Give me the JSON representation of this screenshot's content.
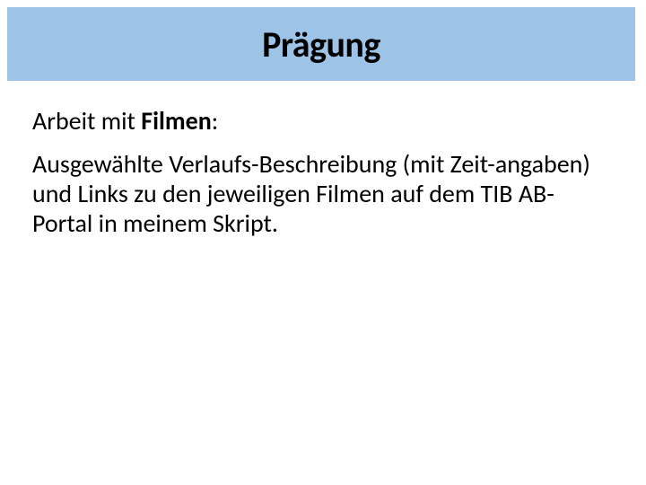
{
  "title": "Prägung",
  "subheading": {
    "prefix": "Arbeit mit ",
    "emph": "Filmen",
    "suffix": ":"
  },
  "paragraph": "Ausgewählte Verlaufs-Beschreibung (mit Zeit-angaben) und Links zu den jeweiligen Filmen auf dem TIB AB-Portal in meinem Skript."
}
